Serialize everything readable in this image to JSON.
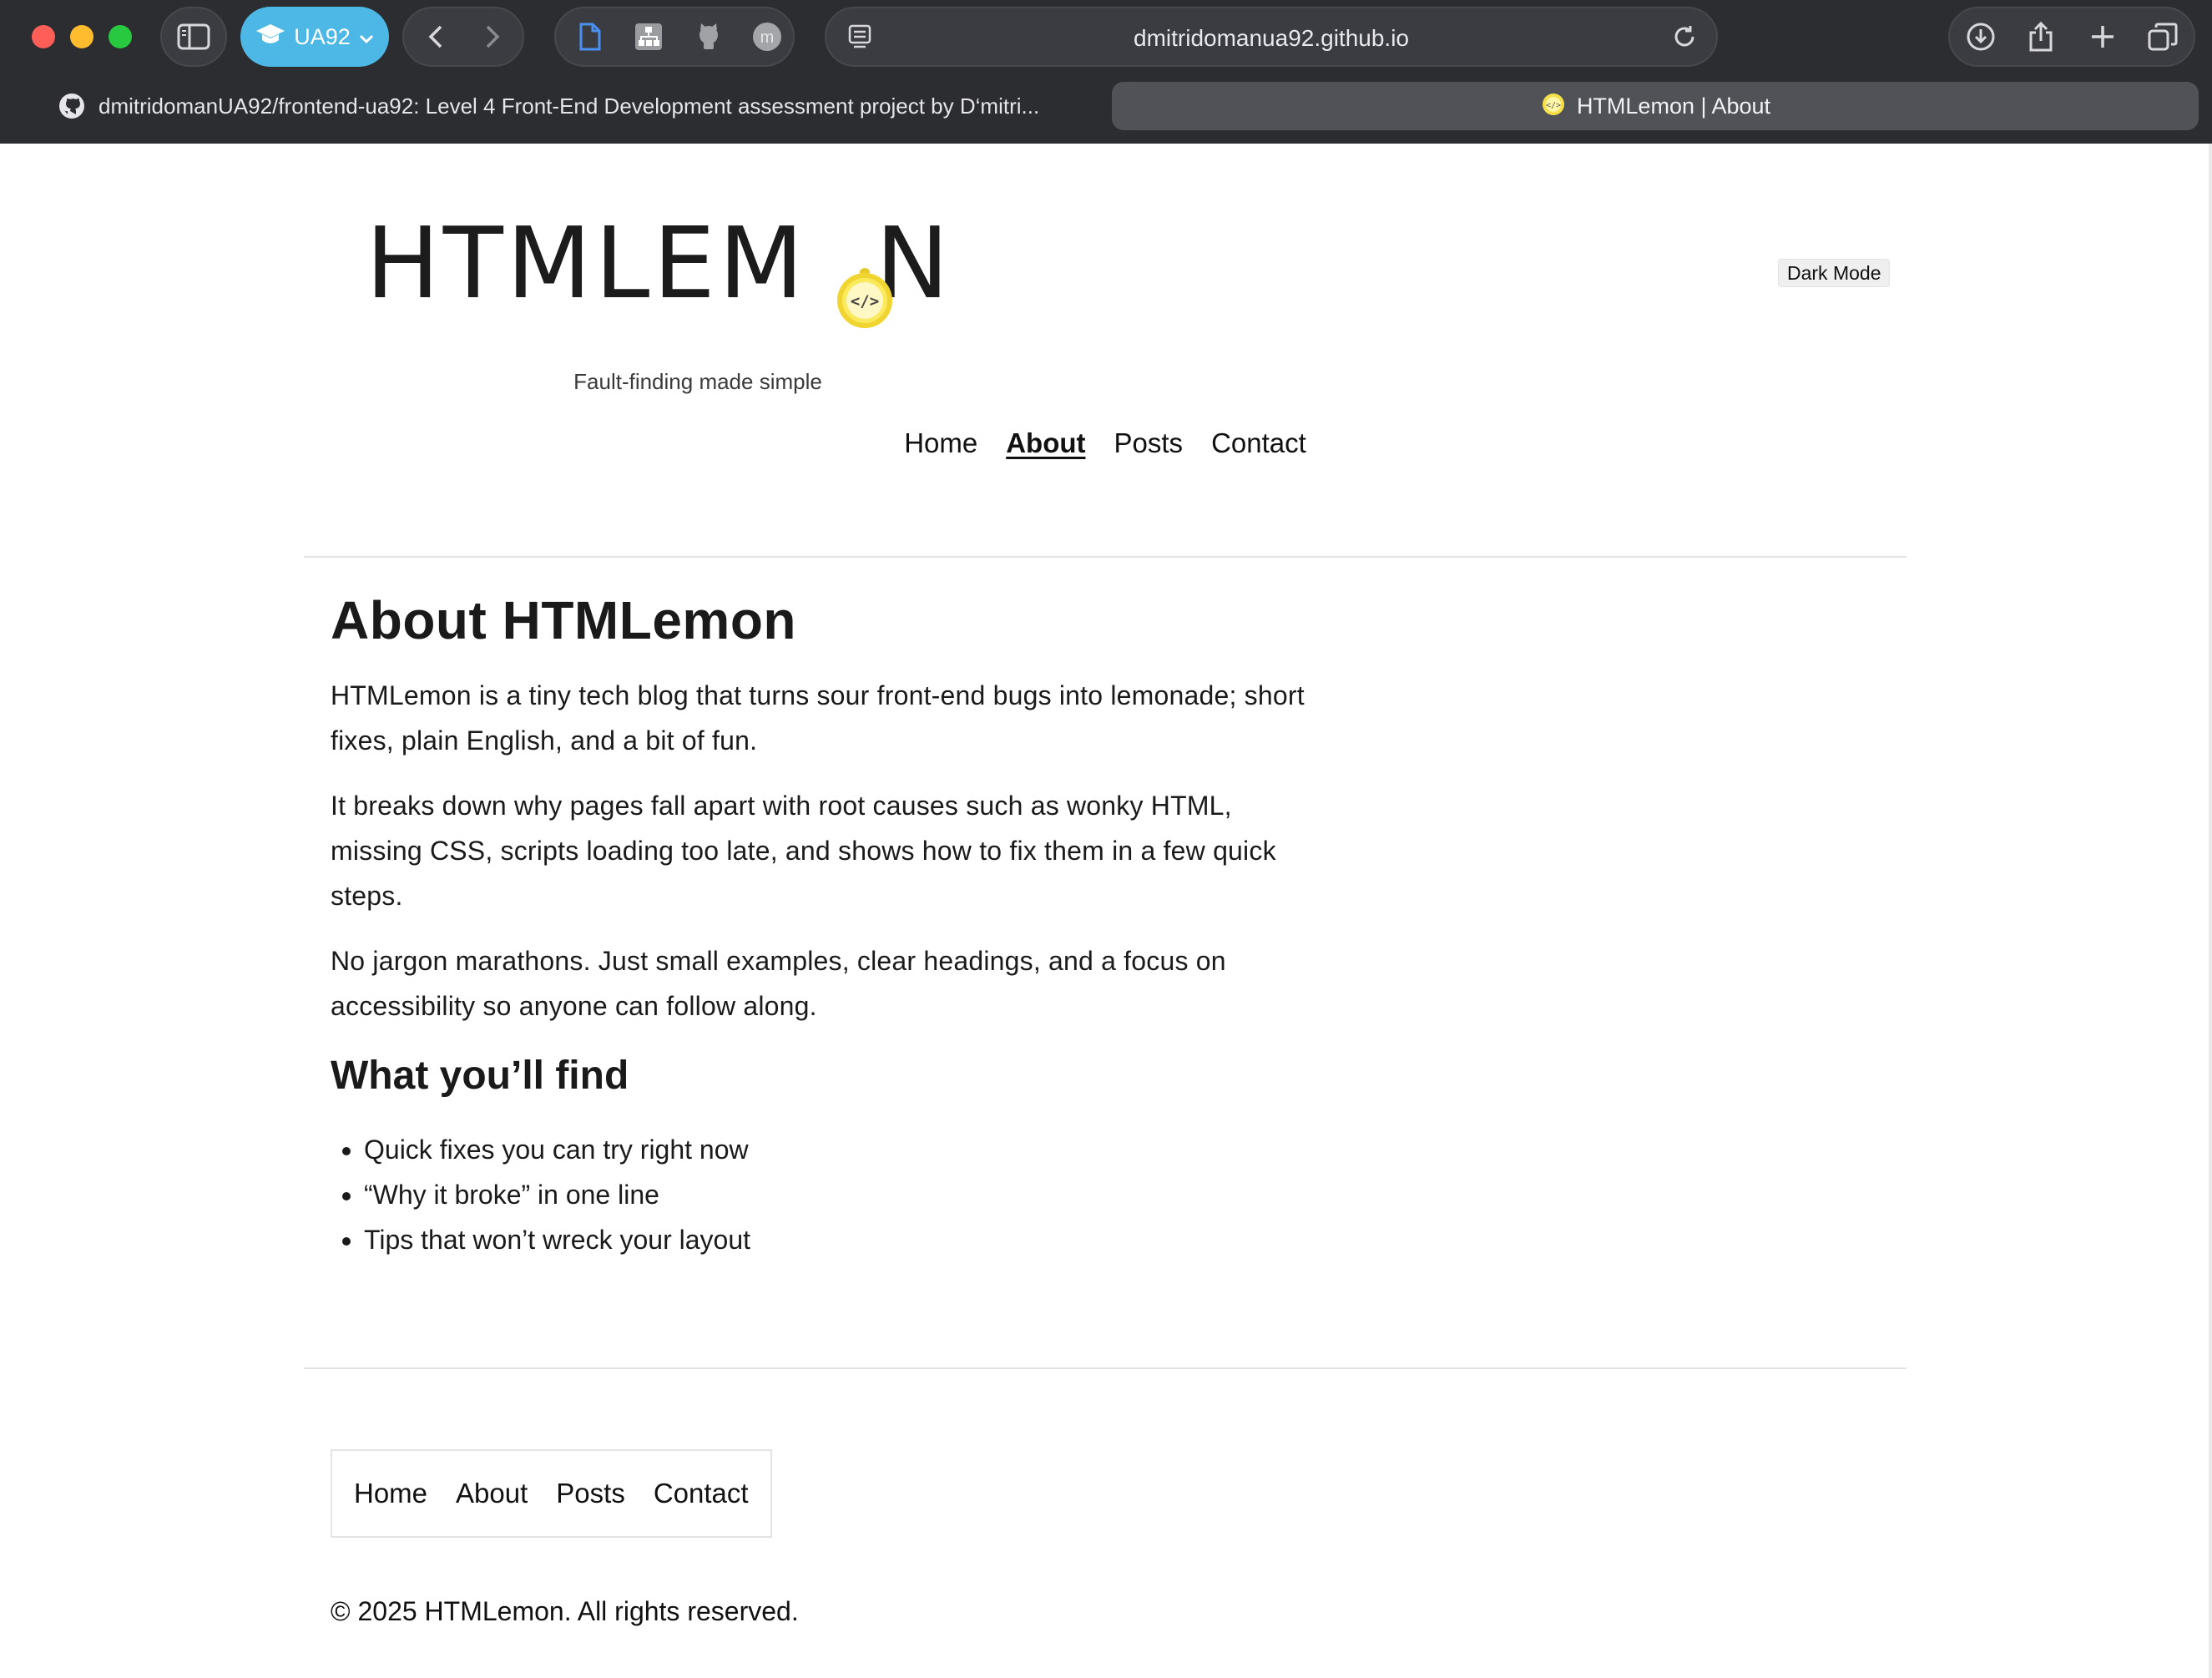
{
  "browser": {
    "profile_label": "UA92",
    "url": "dmitridomanua92.github.io",
    "tabs": [
      {
        "title": "dmitridomanUA92/frontend-ua92: Level 4 Front-End Development assessment project by D‘mitri..."
      },
      {
        "title": "HTMLemon | About"
      }
    ]
  },
  "header": {
    "logo_text": "HTMLEMON",
    "logo_lemon_glyph": "</>",
    "tagline": "Fault-finding made simple",
    "dark_mode_label": "Dark Mode"
  },
  "nav": {
    "items": [
      {
        "label": "Home"
      },
      {
        "label": "About"
      },
      {
        "label": "Posts"
      },
      {
        "label": "Contact"
      }
    ],
    "current": "About"
  },
  "main": {
    "title": "About HTMLemon",
    "paragraphs": [
      "HTMLemon is a tiny tech blog that turns sour front-end bugs into lemonade; short fixes, plain English, and a bit of fun.",
      "It breaks down why pages fall apart with root causes such as wonky HTML, missing CSS, scripts loading too late, and shows how to fix them in a few quick steps.",
      "No jargon marathons. Just small examples, clear headings, and a focus on accessibility so anyone can follow along."
    ],
    "find_title": "What you’ll find",
    "find_items": [
      "Quick fixes you can try right now",
      "“Why it broke” in one line",
      "Tips that won’t wreck your layout"
    ]
  },
  "footer": {
    "nav": [
      {
        "label": "Home"
      },
      {
        "label": "About"
      },
      {
        "label": "Posts"
      },
      {
        "label": "Contact"
      }
    ],
    "copyright": "© 2025 HTMLemon. All rights reserved."
  },
  "colors": {
    "chrome_bg": "#2b2d31",
    "profile_accent": "#4db8e6",
    "lemon_yellow": "#f5e04a",
    "text": "#1a1a1a"
  },
  "icons": [
    "sidebar-icon",
    "graduation-cap-icon",
    "chevron-down-icon",
    "back-icon",
    "forward-icon",
    "document-icon",
    "sitemap-icon",
    "octocat-icon",
    "profile-m-icon",
    "reader-icon",
    "reload-icon",
    "download-icon",
    "share-icon",
    "new-tab-icon",
    "tab-overview-icon",
    "github-icon",
    "lemon-favicon-icon"
  ]
}
